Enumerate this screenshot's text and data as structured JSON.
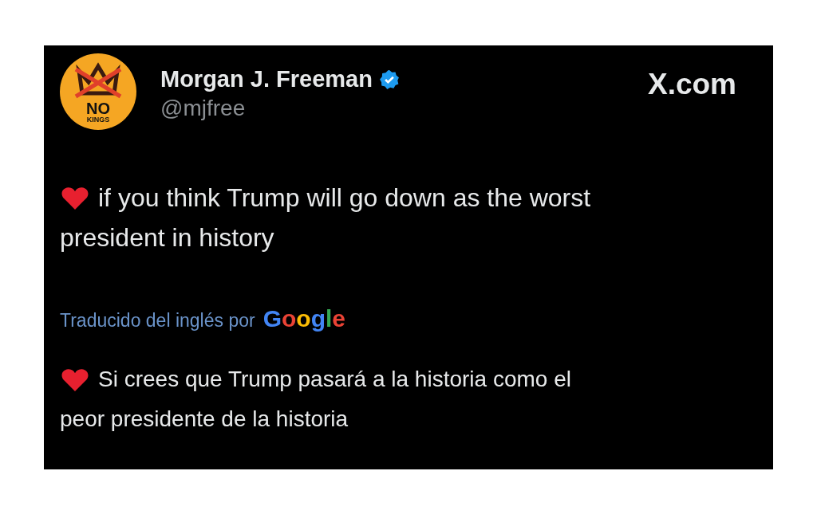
{
  "post": {
    "avatar": {
      "line_1": "NO",
      "line_2": "KINGS"
    },
    "author": {
      "name": "Morgan J. Freeman",
      "verified": true,
      "handle": "@mjfree"
    },
    "site": "X.com",
    "text_lines": [
      "if you think Trump will go down as the worst",
      "president in history"
    ],
    "translation": {
      "note": "Traducido del inglés por",
      "provider": "Google",
      "text_lines": [
        "Si crees que Trump pasará a la historia como el",
        "peor presidente de la historia"
      ]
    }
  }
}
